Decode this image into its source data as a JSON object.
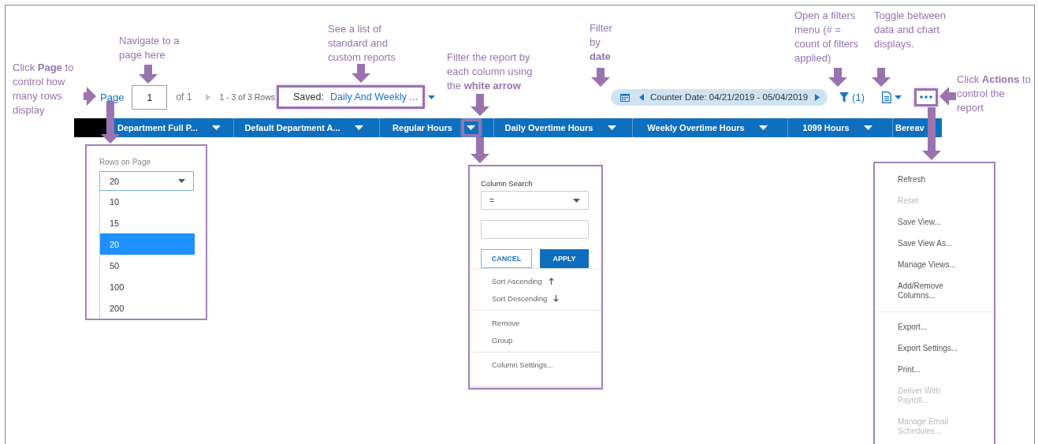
{
  "callouts": [
    {
      "text": "Click **Page** to control how many rows display"
    },
    {
      "text": "Navigate to a page here"
    },
    {
      "text": "See a list of standard and custom reports"
    },
    {
      "text": "Filter the report by each column using the **white arrow**"
    },
    {
      "text": "Filter by **date**"
    },
    {
      "text": "Open a filters menu (# = count of filters applied)"
    },
    {
      "text": "Toggle between data and chart displays."
    },
    {
      "text": "Click **Actions** to control the report"
    }
  ],
  "toolbar": {
    "page_link": "Page",
    "page_value": "1",
    "page_total": "of 1",
    "rows_count": "1 - 3 of 3 Rows",
    "saved_label": "Saved:",
    "saved_value": "Daily And Weekly ...",
    "saved_highlighted": true,
    "date_filter": "Counter Date: 04/21/2019 - 05/04/2019",
    "filter_count": "(1)",
    "actions_highlighted": true
  },
  "columns": [
    {
      "label": "Department Full P...",
      "highlighted": false
    },
    {
      "label": "Default Department A...",
      "highlighted": false
    },
    {
      "label": "Regular Hours",
      "highlighted": true
    },
    {
      "label": "Daily Overtime Hours",
      "highlighted": false
    },
    {
      "label": "Weekly Overtime Hours",
      "highlighted": false
    },
    {
      "label": "1099 Hours",
      "highlighted": false
    },
    {
      "label": "Bereav",
      "highlighted": false
    }
  ],
  "rows_menu": {
    "label": "Rows on Page",
    "value": "20",
    "options": [
      {
        "label": "10",
        "selected": false
      },
      {
        "label": "15",
        "selected": false
      },
      {
        "label": "20",
        "selected": true
      },
      {
        "label": "50",
        "selected": false
      },
      {
        "label": "100",
        "selected": false
      },
      {
        "label": "200",
        "selected": false
      }
    ]
  },
  "column_menu": {
    "label": "Column Search",
    "operator": "=",
    "buttons": [
      {
        "label": "CANCEL",
        "kind": "secondary"
      },
      {
        "label": "APPLY",
        "kind": "primary"
      }
    ],
    "groups": [
      {
        "items": [
          {
            "label": "Sort Ascending",
            "kind": "sort-ascending"
          },
          {
            "label": "Sort Descending",
            "kind": "sort-descending"
          }
        ]
      },
      {
        "items": [
          {
            "label": "Remove",
            "kind": "plain"
          },
          {
            "label": "Group",
            "kind": "plain"
          }
        ]
      },
      {
        "items": [
          {
            "label": "Column Settings...",
            "kind": "plain"
          }
        ]
      }
    ]
  },
  "actions_menu": {
    "groups": [
      {
        "items": [
          {
            "label": "Refresh",
            "disabled": false
          },
          {
            "label": "Reset",
            "disabled": true
          },
          {
            "label": "Save View...",
            "disabled": false
          },
          {
            "label": "Save View As...",
            "disabled": false
          },
          {
            "label": "Manage Views...",
            "disabled": false
          },
          {
            "label": "Add/Remove Columns...",
            "disabled": false
          }
        ]
      },
      {
        "items": [
          {
            "label": "Export...",
            "disabled": false
          },
          {
            "label": "Export Settings...",
            "disabled": false
          },
          {
            "label": "Print...",
            "disabled": false
          },
          {
            "label": "Deliver With Payroll...",
            "disabled": true
          },
          {
            "label": "Manage Email Schedules...",
            "disabled": true
          }
        ]
      }
    ]
  }
}
